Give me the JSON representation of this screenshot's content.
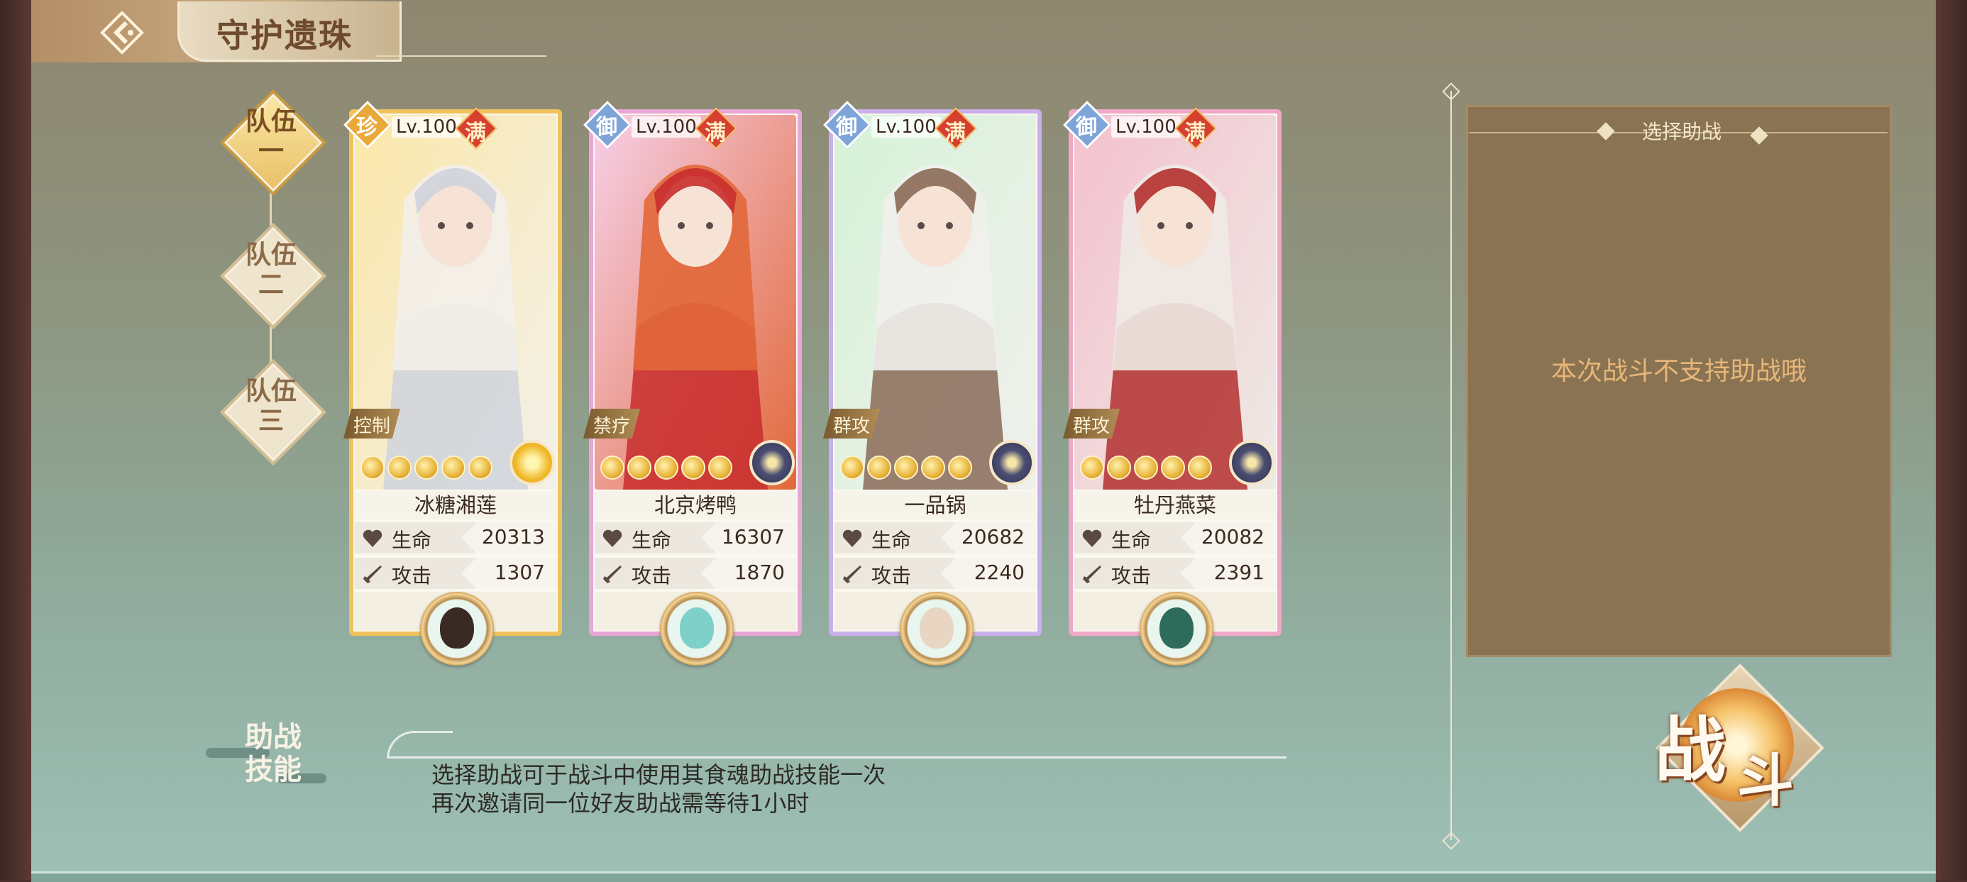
{
  "header": {
    "title": "守护遗珠",
    "back_icon": "back-arrow-icon"
  },
  "teams": [
    {
      "label": "队伍一",
      "line1": "队伍",
      "line2": "一",
      "active": true
    },
    {
      "label": "队伍二",
      "line1": "队伍",
      "line2": "二",
      "active": false
    },
    {
      "label": "队伍三",
      "line1": "队伍",
      "line2": "三",
      "active": false
    }
  ],
  "cards": [
    {
      "grade": "珍",
      "level": "Lv.100",
      "full": "满",
      "role": "控制",
      "stars": 5,
      "name": "冰糖湘莲",
      "hp_label": "生命",
      "hp": "20313",
      "atk_label": "攻击",
      "atk": "1307",
      "border_color": "#f1c25b",
      "grade_color": "#e9a93a",
      "element": "flower-icon"
    },
    {
      "grade": "御",
      "level": "Lv.100",
      "full": "满",
      "role": "禁疗",
      "stars": 5,
      "name": "北京烤鸭",
      "hp_label": "生命",
      "hp": "16307",
      "atk_label": "攻击",
      "atk": "1870",
      "border_color": "#e9a6d6",
      "grade_color": "#7fa5d8",
      "element": "lotus-icon"
    },
    {
      "grade": "御",
      "level": "Lv.100",
      "full": "满",
      "role": "群攻",
      "stars": 5,
      "name": "一品锅",
      "hp_label": "生命",
      "hp": "20682",
      "atk_label": "攻击",
      "atk": "2240",
      "border_color": "#c9b0ea",
      "grade_color": "#7fa5d8",
      "element": "lotus-icon"
    },
    {
      "grade": "御",
      "level": "Lv.100",
      "full": "满",
      "role": "群攻",
      "stars": 5,
      "name": "牡丹燕菜",
      "hp_label": "生命",
      "hp": "20082",
      "atk_label": "攻击",
      "atk": "2391",
      "border_color": "#f0a8c8",
      "grade_color": "#7fa5d8",
      "element": "lotus-icon"
    }
  ],
  "helper": {
    "title": "选择助战",
    "message": "本次战斗不支持助战哦"
  },
  "skill": {
    "title_line1": "助战",
    "title_line2": "技能",
    "desc_line1": "选择助战可于战斗中使用其食魂助战技能一次",
    "desc_line2": "再次邀请同一位好友助战需等待1小时"
  },
  "battle": {
    "char1": "战",
    "char2": "斗"
  }
}
